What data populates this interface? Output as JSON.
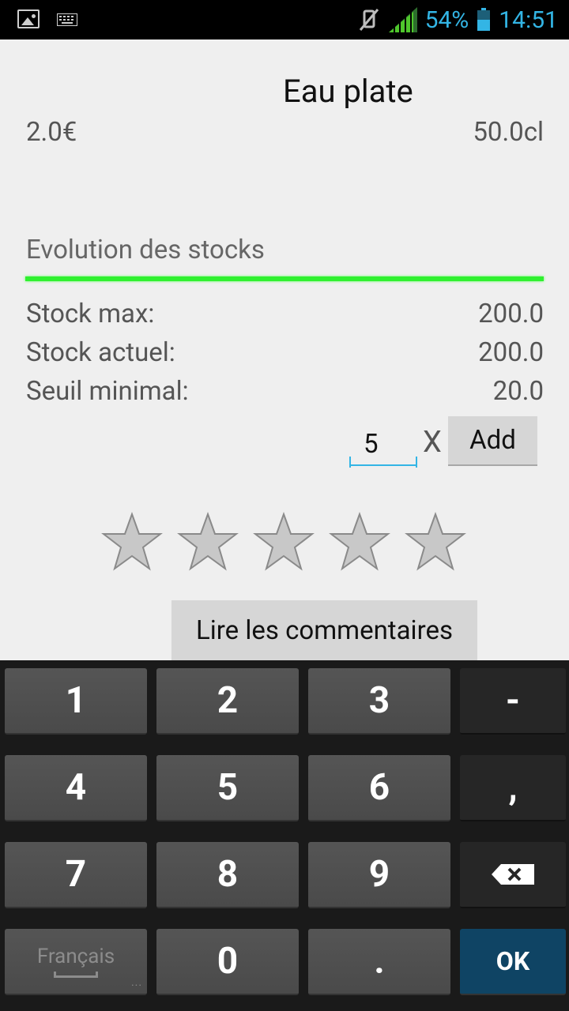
{
  "status_bar": {
    "battery_percent": "54%",
    "time": "14:51"
  },
  "product": {
    "name": "Eau plate",
    "price": "2.0€",
    "volume": "50.0cl"
  },
  "stock": {
    "section_title": "Evolution des stocks",
    "level_fraction": 1.0,
    "rows": [
      {
        "label": "Stock max:",
        "value": "200.0"
      },
      {
        "label": "Stock actuel:",
        "value": "200.0"
      },
      {
        "label": "Seuil minimal:",
        "value": "20.0"
      }
    ]
  },
  "add_form": {
    "quantity": "5",
    "multiplier_label": "X",
    "add_label": "Add"
  },
  "rating": {
    "filled": 0,
    "max": 5
  },
  "comments_button": "Lire les commentaires",
  "keyboard": {
    "keys": [
      "1",
      "2",
      "3",
      "-",
      "4",
      "5",
      "6",
      ",",
      "7",
      "8",
      "9",
      "0",
      "."
    ],
    "language": "Français",
    "ok_label": "OK"
  },
  "colors": {
    "accent": "#33b5e5",
    "progress": "#2ff02f",
    "ok_key": "#0f4464"
  }
}
